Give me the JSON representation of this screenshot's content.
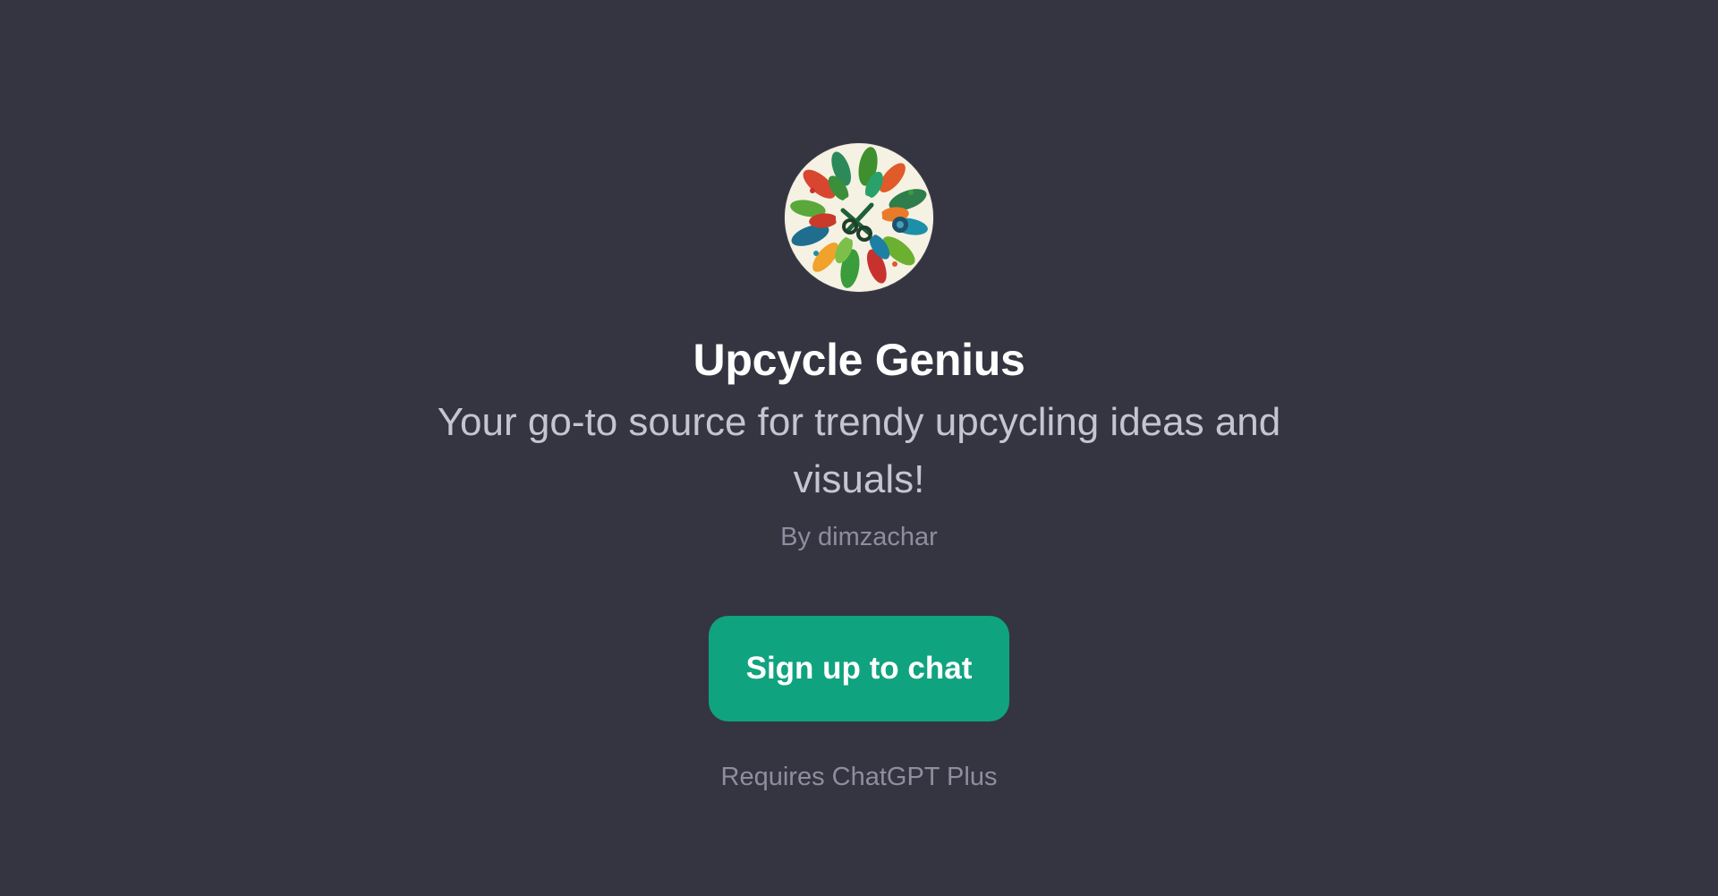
{
  "gpt": {
    "avatar_icon": "upcycle-leaf-wreath-logo",
    "title": "Upcycle Genius",
    "description": "Your go-to source for trendy upcycling ideas and visuals!",
    "author": "By dimzachar"
  },
  "cta": {
    "signup_label": "Sign up to chat",
    "requirement": "Requires ChatGPT Plus"
  },
  "colors": {
    "background": "#343541",
    "accent": "#10a37f",
    "title": "#ffffff",
    "subtitle": "#c5c5d2",
    "muted": "#8e8ea0"
  }
}
